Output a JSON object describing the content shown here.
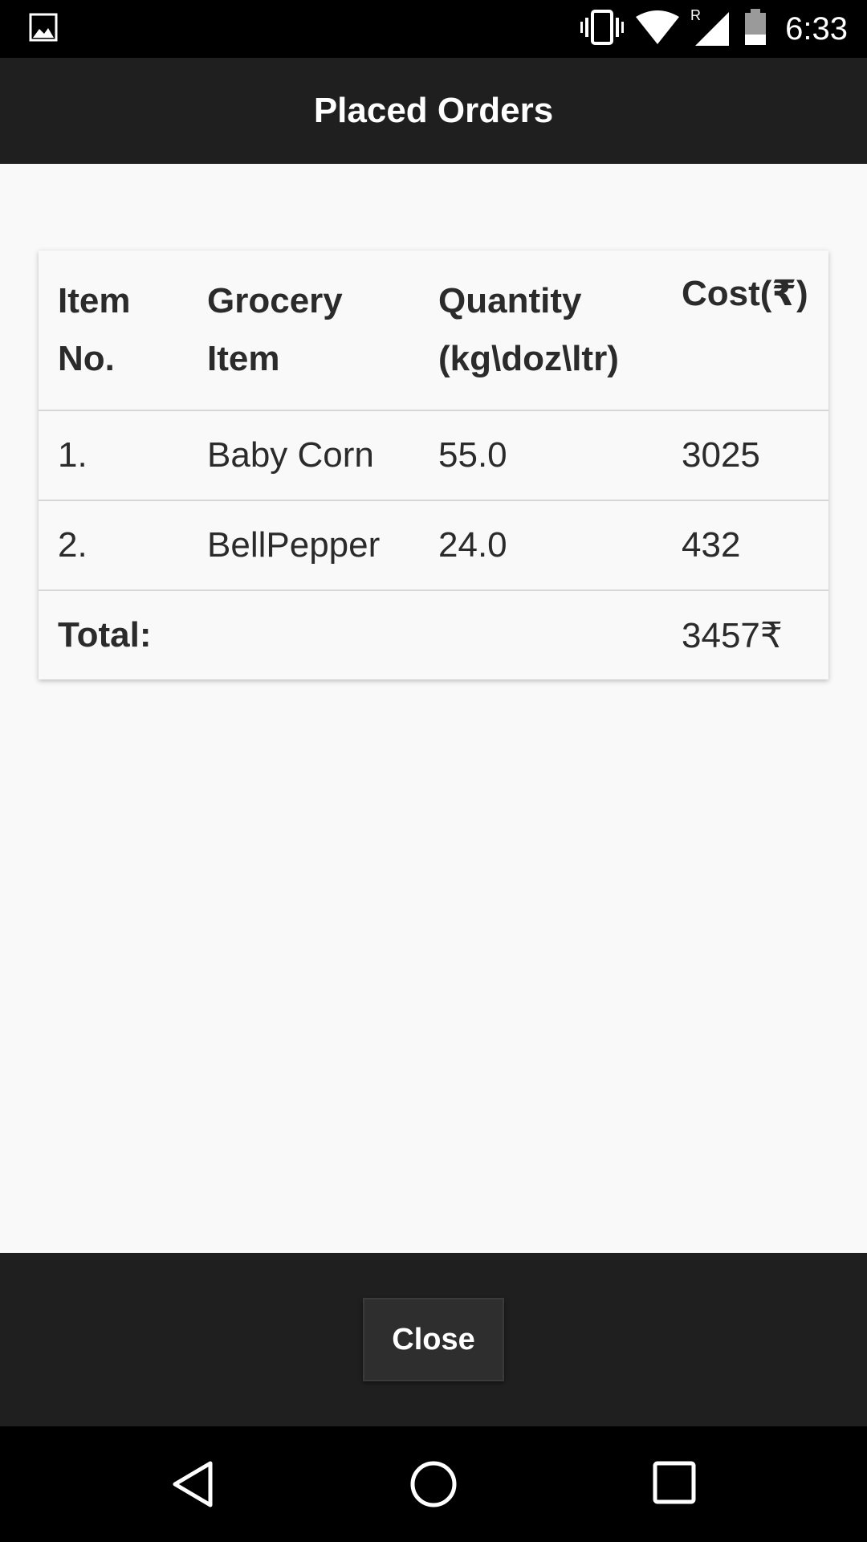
{
  "status_bar": {
    "time": "6:33",
    "icons": [
      "image-icon",
      "vibrate-icon",
      "wifi-icon",
      "roaming-signal-icon",
      "battery-icon"
    ],
    "roaming_label": "R"
  },
  "header": {
    "title": "Placed Orders",
    "background": "#1f1f1f"
  },
  "table": {
    "headers": {
      "item_no_line1": "Item",
      "item_no_line2": "No.",
      "grocery_line1": "Grocery",
      "grocery_line2": "Item",
      "quantity_line1": "Quantity",
      "quantity_line2": "(kg\\doz\\ltr)",
      "cost": "Cost(₹)"
    },
    "rows": [
      {
        "no": "1.",
        "item": "Baby Corn",
        "quantity": "55.0",
        "cost": "3025"
      },
      {
        "no": "2.",
        "item": "BellPepper",
        "quantity": "24.0",
        "cost": "432"
      }
    ],
    "total_label": "Total:",
    "total_value": "3457₹"
  },
  "footer": {
    "close_label": "Close"
  },
  "nav_bar": {
    "icons": [
      "back-icon",
      "home-icon",
      "recents-icon"
    ]
  }
}
